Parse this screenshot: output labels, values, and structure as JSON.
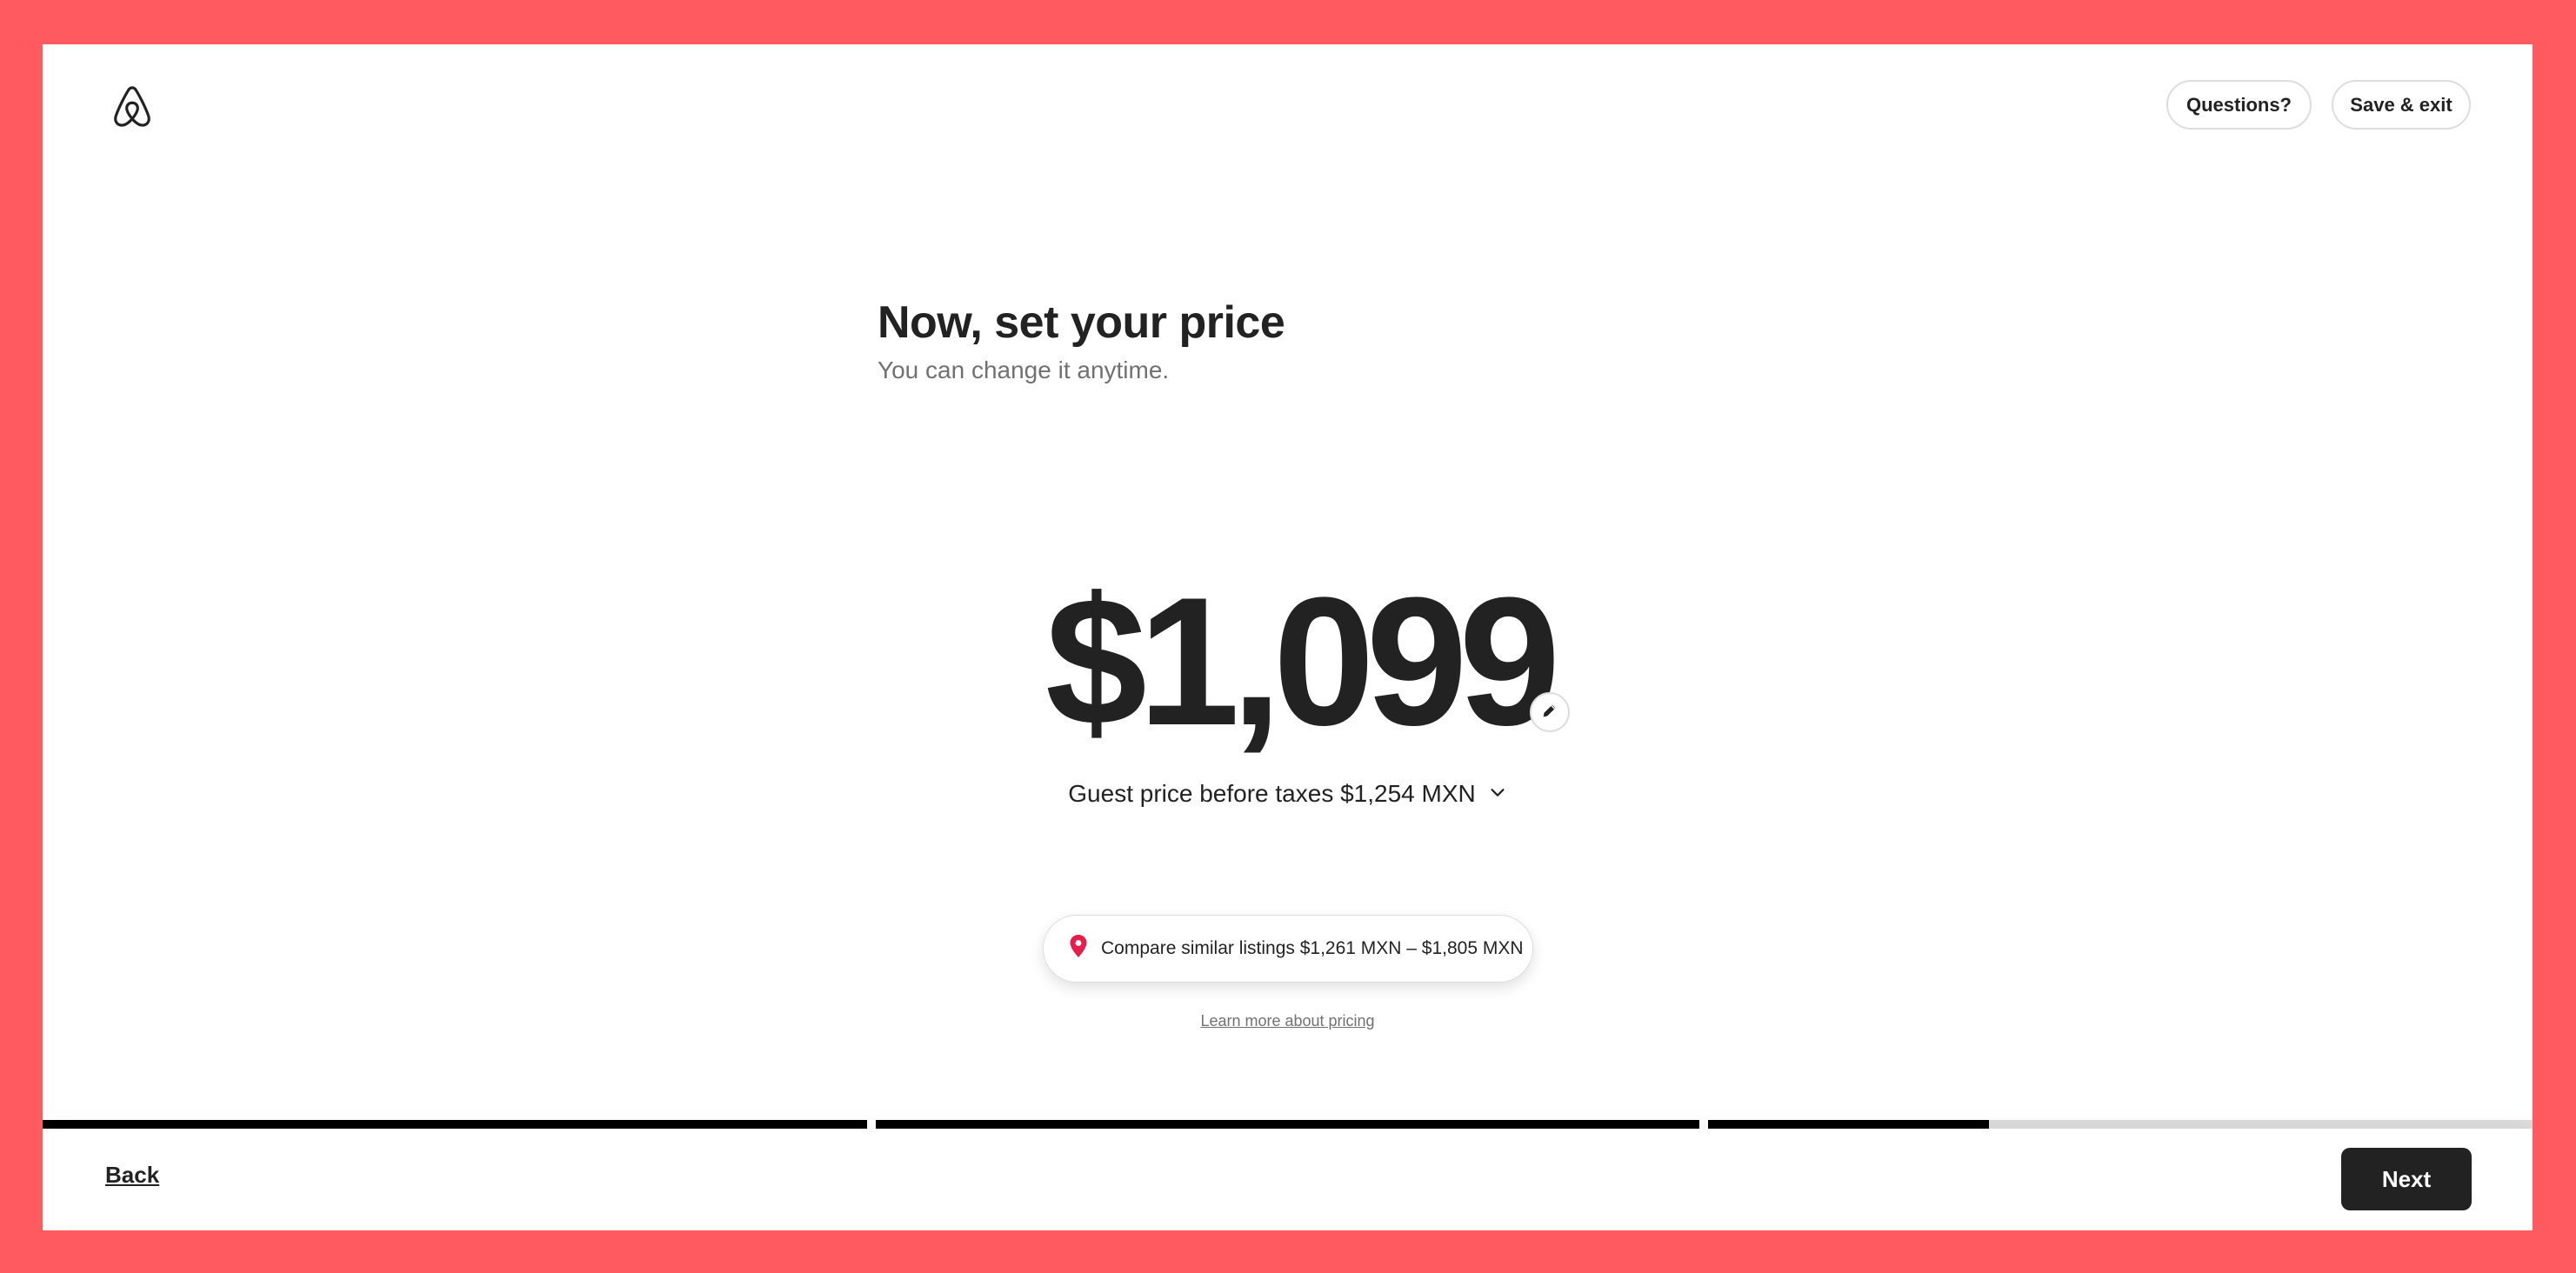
{
  "brand": {
    "frame_color": "#FF5A5F",
    "accent": "#E61E4D",
    "logo_icon": "airbnb-logo-icon"
  },
  "header": {
    "questions_label": "Questions?",
    "save_exit_label": "Save & exit"
  },
  "main": {
    "title": "Now, set your price",
    "subtitle": "You can change it anytime.",
    "price": "$1,099",
    "edit_icon": "pencil-icon",
    "guest_price_label": "Guest price before taxes $1,254 MXN",
    "guest_price_icon": "chevron-down-icon",
    "compare_icon": "map-pin-icon",
    "compare_label": "Compare similar listings $1,261 MXN – $1,805 MXN",
    "learn_more_label": "Learn more about pricing"
  },
  "progress": {
    "segments": [
      1.0,
      1.0,
      0.34
    ]
  },
  "footer": {
    "back_label": "Back",
    "next_label": "Next"
  }
}
